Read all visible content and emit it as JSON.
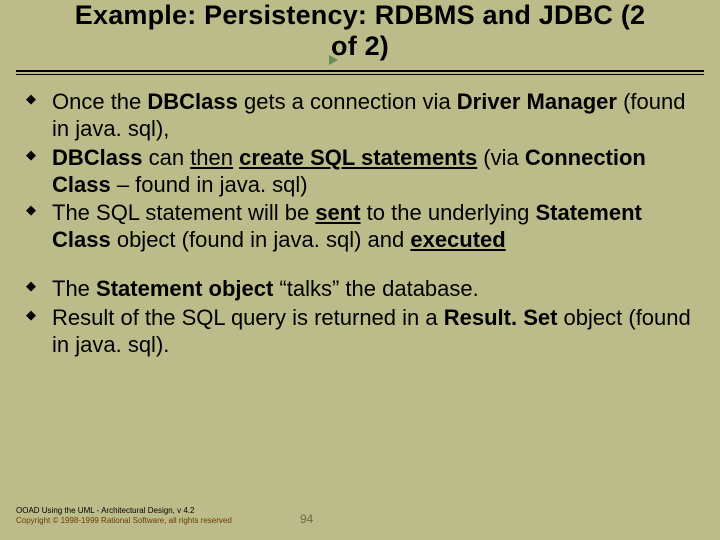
{
  "title": {
    "line1": "Example: Persistency: RDBMS and JDBC (2",
    "line2": "of 2)"
  },
  "bullets_group1": [
    {
      "pre": "Once the ",
      "b1": "DBClass",
      "mid1": " gets a connection via ",
      "b2": "Driver Manager",
      "mid2": " (found in java. sql),"
    },
    {
      "b1": "DBClass",
      "mid1": " can ",
      "u1": "then",
      "mid2": " ",
      "bu1": "create SQL statements",
      "mid3": " (via ",
      "b2": "Connection Class",
      "mid4": " – found in java. sql)"
    },
    {
      "pre": "The SQL statement will be ",
      "bu1": "sent",
      "mid1": " to the underlying ",
      "b1": "Statement Class",
      "mid2": " object (found in java. sql) and ",
      "bu2": "executed"
    }
  ],
  "bullets_group2": [
    {
      "pre": "The ",
      "b1": "Statement object",
      "mid1": " “talks” the database."
    },
    {
      "pre": "Result of the SQL query is returned in a ",
      "b1": "Result. Set",
      "mid1": " object (found in java. sql)."
    }
  ],
  "footer": {
    "line1": "OOAD Using the UML - Architectural Design, v 4.2",
    "line2": "Copyright © 1998-1999 Rational Software, all rights reserved"
  },
  "page_number": "94"
}
